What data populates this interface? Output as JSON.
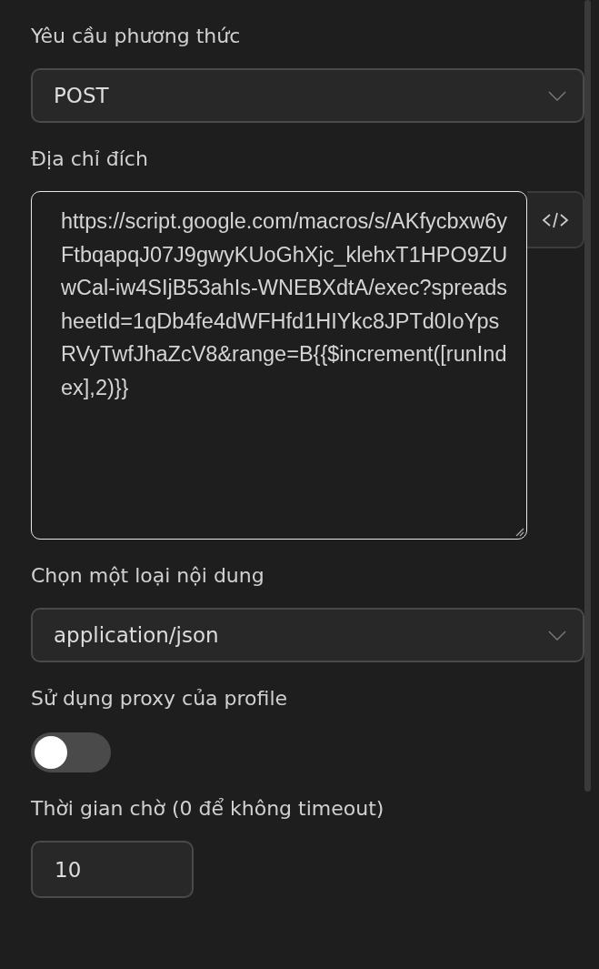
{
  "method": {
    "label": "Yêu cầu phương thức",
    "value": "POST"
  },
  "target": {
    "label": "Địa chỉ đích",
    "value": "https://script.google.com/macros/s/AKfycbxw6yFtbqapqJ07J9gwyKUoGhXjc_klehxT1HPO9ZUwCal-iw4SIjB53ahIs-WNEBXdtA/exec?spreadsheetId=1qDb4fe4dWFHfd1HIYkc8JPTd0IoYpsRVyTwfJhaZcV8&range=B{{$increment([runIndex],2)}}"
  },
  "content_type": {
    "label": "Chọn một loại nội dung",
    "value": "application/json"
  },
  "use_proxy": {
    "label": "Sử dụng proxy của profile",
    "on": false
  },
  "timeout": {
    "label": "Thời gian chờ (0 để không timeout)",
    "value": "10"
  }
}
